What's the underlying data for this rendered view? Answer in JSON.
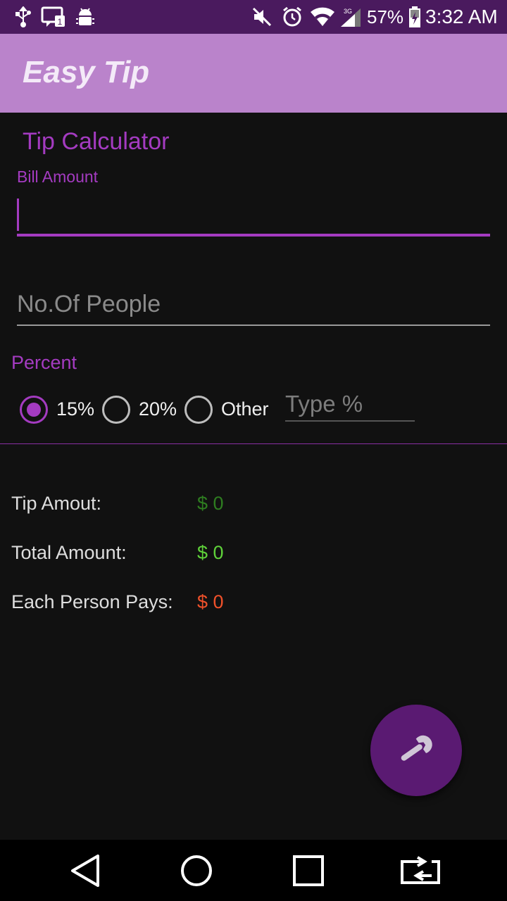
{
  "status_bar": {
    "battery": "57%",
    "time": "3:32 AM",
    "network_type": "3G",
    "sim_badge": "1",
    "icons": [
      "usb-icon",
      "sim-card-icon",
      "android-debug-icon",
      "mute-icon",
      "alarm-icon",
      "wifi-icon",
      "cell-signal-icon",
      "battery-charging-icon"
    ]
  },
  "app_bar": {
    "title": "Easy Tip"
  },
  "form": {
    "section_title": "Tip Calculator",
    "bill_label": "Bill Amount",
    "bill_value": "",
    "people_placeholder": "No.Of People",
    "percent_label": "Percent",
    "options": [
      "15%",
      "20%",
      "Other"
    ],
    "selected_option": "15%",
    "other_placeholder": "Type %"
  },
  "results": {
    "tip_label": "Tip Amout:",
    "tip_value": "$ 0",
    "total_label": "Total Amount:",
    "total_value": "$ 0",
    "each_label": "Each Person Pays:",
    "each_value": "$ 0"
  },
  "colors": {
    "accent": "#a43bc1",
    "status_bar": "#4a1a5e",
    "app_bar": "#ba83cb",
    "tip_value": "#2e7d20",
    "total_value": "#5fd33a",
    "each_value": "#f0512a",
    "fab": "#5a1a72"
  },
  "fab": {
    "icon": "wrench-icon"
  },
  "nav_bar": {
    "icons": [
      "back-icon",
      "home-icon",
      "recents-icon",
      "switch-app-icon"
    ]
  }
}
